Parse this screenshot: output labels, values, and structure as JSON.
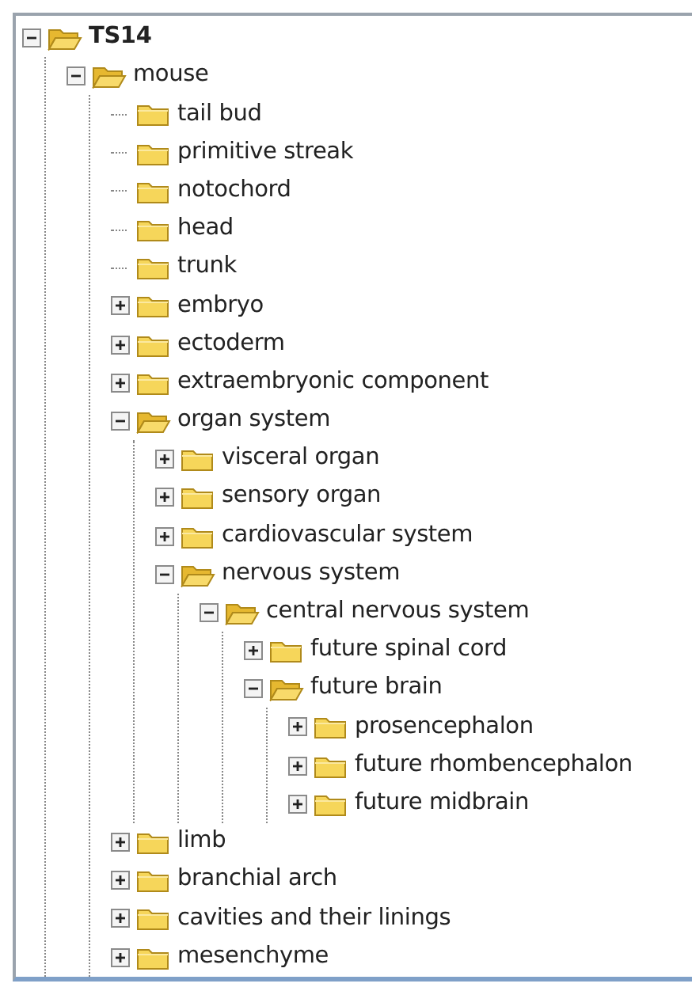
{
  "tree": [
    {
      "label": "TS14",
      "kind": "branch",
      "expanded": true,
      "children": [
        {
          "label": "mouse",
          "kind": "branch",
          "expanded": true,
          "children": [
            {
              "label": "tail bud",
              "kind": "leaf"
            },
            {
              "label": "primitive streak",
              "kind": "leaf"
            },
            {
              "label": "notochord",
              "kind": "leaf"
            },
            {
              "label": "head",
              "kind": "leaf"
            },
            {
              "label": "trunk",
              "kind": "leaf"
            },
            {
              "label": "embryo",
              "kind": "branch",
              "expanded": false
            },
            {
              "label": "ectoderm",
              "kind": "branch",
              "expanded": false
            },
            {
              "label": "extraembryonic component",
              "kind": "branch",
              "expanded": false
            },
            {
              "label": "organ system",
              "kind": "branch",
              "expanded": true,
              "children": [
                {
                  "label": "visceral organ",
                  "kind": "branch",
                  "expanded": false
                },
                {
                  "label": "sensory organ",
                  "kind": "branch",
                  "expanded": false
                },
                {
                  "label": "cardiovascular system",
                  "kind": "branch",
                  "expanded": false
                },
                {
                  "label": "nervous system",
                  "kind": "branch",
                  "expanded": true,
                  "children": [
                    {
                      "label": "central nervous system",
                      "kind": "branch",
                      "expanded": true,
                      "children": [
                        {
                          "label": "future spinal cord",
                          "kind": "branch",
                          "expanded": false
                        },
                        {
                          "label": "future brain",
                          "kind": "branch",
                          "expanded": true,
                          "children": [
                            {
                              "label": "prosencephalon",
                              "kind": "branch",
                              "expanded": false
                            },
                            {
                              "label": "future rhombencephalon",
                              "kind": "branch",
                              "expanded": false
                            },
                            {
                              "label": "future midbrain",
                              "kind": "branch",
                              "expanded": false
                            }
                          ]
                        }
                      ]
                    }
                  ]
                }
              ]
            },
            {
              "label": "limb",
              "kind": "branch",
              "expanded": false
            },
            {
              "label": "branchial arch",
              "kind": "branch",
              "expanded": false
            },
            {
              "label": "cavities and their linings",
              "kind": "branch",
              "expanded": false
            },
            {
              "label": "mesenchyme",
              "kind": "branch",
              "expanded": false
            }
          ]
        }
      ]
    }
  ]
}
